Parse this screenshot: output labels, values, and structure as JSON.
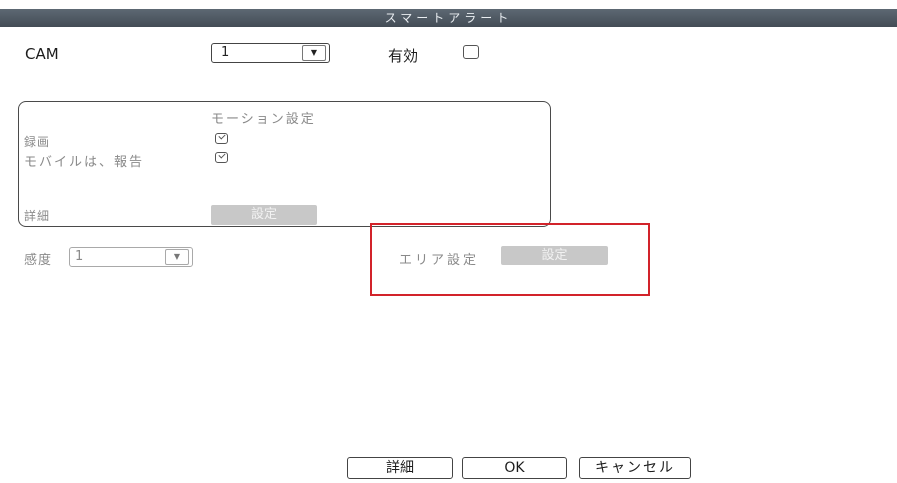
{
  "window": {
    "title": "スマートアラート"
  },
  "cam": {
    "label": "CAM",
    "value": "1"
  },
  "enable": {
    "label": "有効",
    "checked": false
  },
  "motion": {
    "heading": "モーション設定",
    "record": {
      "label": "録画",
      "checked": true
    },
    "mobile_report": {
      "label": "モバイルは、報告",
      "checked": true
    },
    "details": {
      "label": "詳細",
      "button": "設定"
    }
  },
  "sensitivity": {
    "label": "感度",
    "value": "1"
  },
  "area": {
    "label": "エリア設定",
    "button": "設定"
  },
  "footer": {
    "details": "詳細",
    "ok": "OK",
    "cancel": "キャンセル"
  },
  "colors": {
    "highlight": "#d2232a",
    "titlebar": "#4b545d"
  }
}
